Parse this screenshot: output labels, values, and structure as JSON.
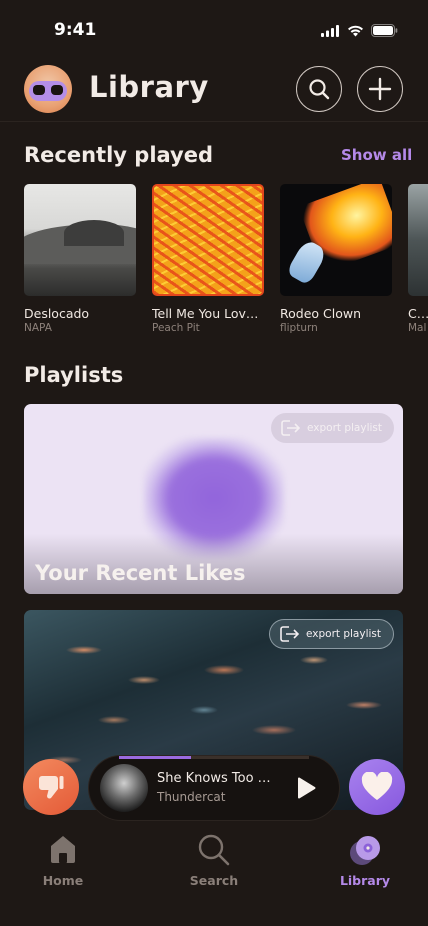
{
  "status_bar": {
    "time": "9:41",
    "icons": [
      "signal-icon",
      "wifi-icon",
      "battery-icon"
    ]
  },
  "header": {
    "title": "Library",
    "search_icon": "search-icon",
    "add_icon": "plus-icon"
  },
  "recently_played": {
    "title": "Recently played",
    "show_all": "Show all",
    "items": [
      {
        "title": "Deslocado",
        "artist": "NAPA"
      },
      {
        "title": "Tell Me You Love...",
        "artist": "Peach Pit"
      },
      {
        "title": "Rodeo Clown",
        "artist": "flipturn"
      },
      {
        "title": "Che",
        "artist": "Mal"
      }
    ]
  },
  "playlists": {
    "title": "Playlists",
    "items": [
      {
        "name": "Your Recent Likes",
        "export_label": "export playlist"
      },
      {
        "name": "",
        "export_label": "export playlist"
      }
    ]
  },
  "player": {
    "song": "She Knows Too M...",
    "artist": "Thundercat",
    "progress": 0.38,
    "dislike_icon": "thumbs-down-icon",
    "like_icon": "heart-icon",
    "play_icon": "play-icon"
  },
  "nav": {
    "items": [
      {
        "label": "Home",
        "icon": "home-icon"
      },
      {
        "label": "Search",
        "icon": "search-icon"
      },
      {
        "label": "Library",
        "icon": "library-icon",
        "active": true
      }
    ]
  },
  "colors": {
    "background": "#1e1815",
    "accent": "#b489e8",
    "dislike": "#ea6a43",
    "like": "#9a6ee6",
    "inactive": "#8a7f79"
  }
}
